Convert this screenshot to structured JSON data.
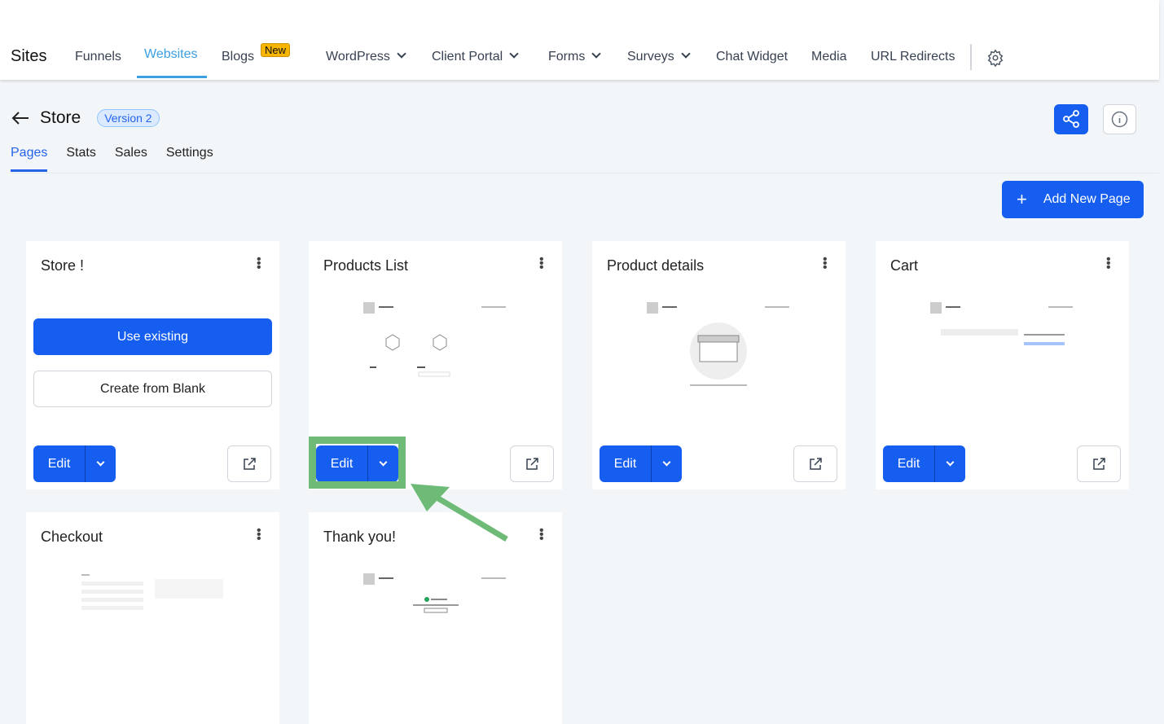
{
  "topnav": {
    "brand": "Sites",
    "items": [
      {
        "label": "Funnels",
        "dropdown": false
      },
      {
        "label": "Websites",
        "dropdown": false,
        "active": true
      },
      {
        "label": "Blogs",
        "dropdown": false,
        "badge": "New"
      },
      {
        "label": "WordPress",
        "dropdown": true
      },
      {
        "label": "Client Portal",
        "dropdown": true
      },
      {
        "label": "Forms",
        "dropdown": true
      },
      {
        "label": "Surveys",
        "dropdown": true
      },
      {
        "label": "Chat Widget",
        "dropdown": false
      },
      {
        "label": "Media",
        "dropdown": false
      },
      {
        "label": "URL Redirects",
        "dropdown": false
      }
    ]
  },
  "header": {
    "title": "Store",
    "version": "Version 2"
  },
  "tabs": [
    {
      "label": "Pages",
      "active": true
    },
    {
      "label": "Stats"
    },
    {
      "label": "Sales"
    },
    {
      "label": "Settings"
    }
  ],
  "add_page_label": "Add New Page",
  "cards": [
    {
      "title": "Store !",
      "use_existing": "Use existing",
      "create_blank": "Create from Blank",
      "edit": "Edit"
    },
    {
      "title": "Products List",
      "edit": "Edit"
    },
    {
      "title": "Product details",
      "edit": "Edit"
    },
    {
      "title": "Cart",
      "edit": "Edit"
    },
    {
      "title": "Checkout"
    },
    {
      "title": "Thank you!"
    }
  ],
  "colors": {
    "primary": "#155eef",
    "highlight": "#6dbb76",
    "badge": "#f7b500"
  }
}
